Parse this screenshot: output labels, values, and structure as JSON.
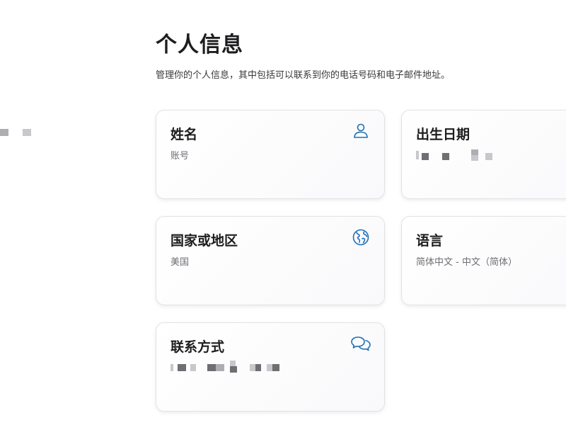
{
  "header": {
    "title": "个人信息",
    "subtitle": "管理你的个人信息，其中包括可以联系到你的电话号码和电子邮件地址。"
  },
  "cards": {
    "name": {
      "title": "姓名",
      "value": "账号",
      "icon": "person-icon"
    },
    "birthday": {
      "title": "出生日期",
      "value_redacted": true
    },
    "region": {
      "title": "国家或地区",
      "value": "美国",
      "icon": "globe-icon"
    },
    "language": {
      "title": "语言",
      "value": "简体中文 - 中文（简体）"
    },
    "contact": {
      "title": "联系方式",
      "value_redacted": true,
      "icon": "chat-bubbles-icon"
    }
  },
  "colors": {
    "accent": "#1f6fb5",
    "card_border": "#e3e3e6",
    "subtext": "#6e6e73"
  }
}
